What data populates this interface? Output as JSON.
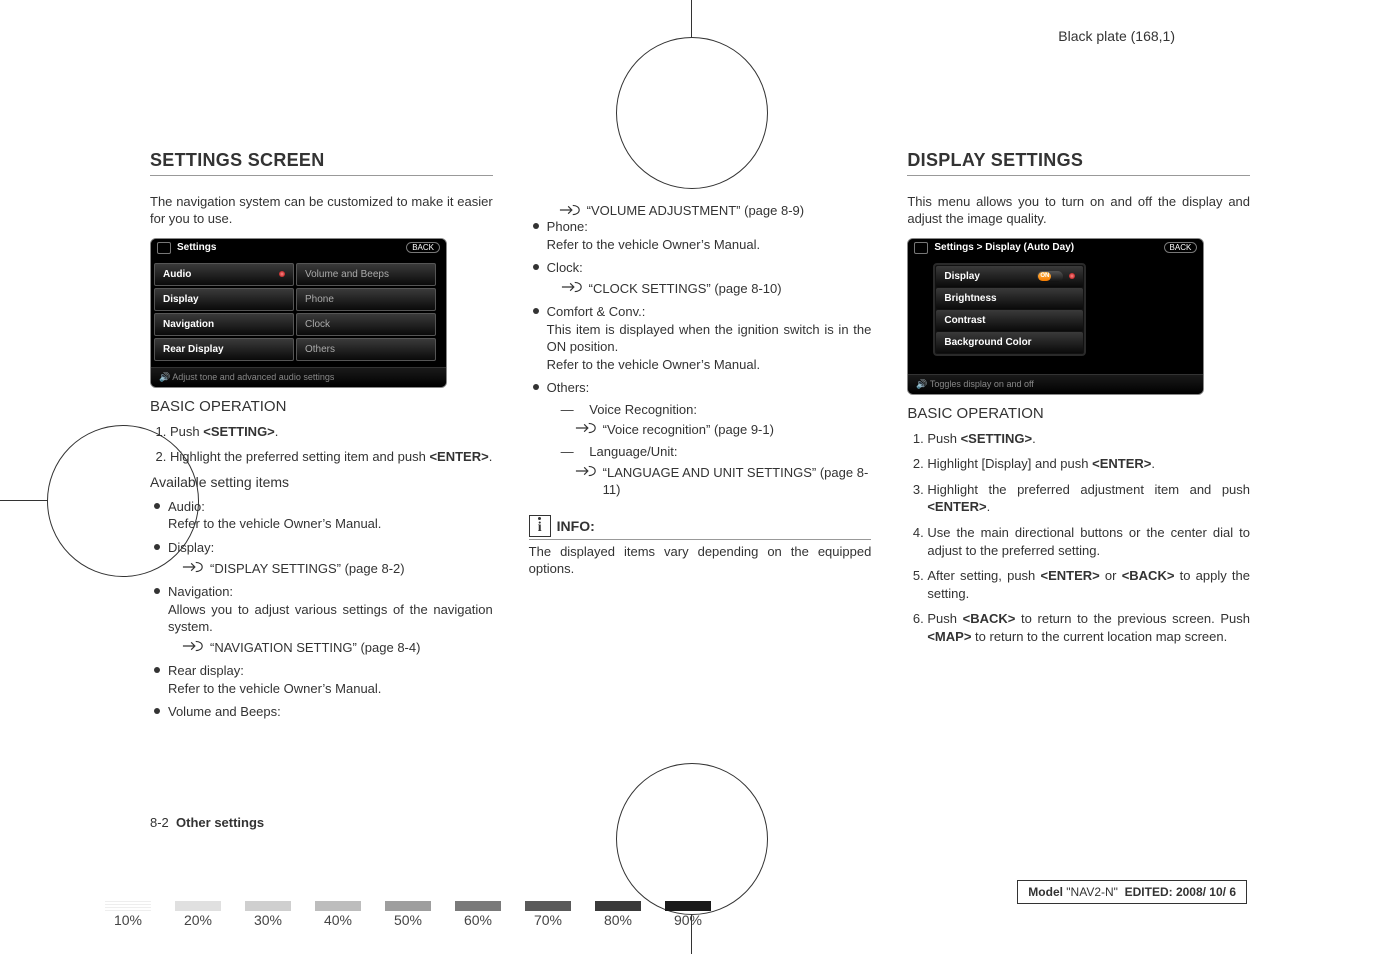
{
  "plate_label": "Black plate (168,1)",
  "col1": {
    "heading": "SETTINGS SCREEN",
    "intro": "The navigation system can be customized to make it easier for you to use.",
    "ss_title": "Settings",
    "ss_back": "BACK",
    "ss_left": [
      "Audio",
      "Display",
      "Navigation",
      "Rear Display"
    ],
    "ss_right": [
      "Volume and Beeps",
      "Phone",
      "Clock",
      "Others"
    ],
    "ss_footer": "Adjust tone and advanced audio settings",
    "sub": "BASIC OPERATION",
    "step1_a": "Push ",
    "step1_b": "<SETTING>",
    "step1_c": ".",
    "step2_a": "Highlight the preferred setting item and push ",
    "step2_b": "<ENTER>",
    "step2_c": ".",
    "avail": "Available setting items",
    "audio_t": "Audio:",
    "audio_d": "Refer to the vehicle Owner’s Manual.",
    "display_t": "Display:",
    "display_x": "“DISPLAY SETTINGS” (page 8-2)",
    "nav_t": "Navigation:",
    "nav_d": "Allows you to adjust various settings of the navigation system.",
    "nav_x": "“NAVIGATION SETTING” (page 8-4)",
    "rear_t": "Rear display:",
    "rear_d": "Refer to the vehicle Owner’s Manual.",
    "vol_t": "Volume and Beeps:"
  },
  "col2": {
    "vol_x": "“VOLUME ADJUSTMENT” (page 8-9)",
    "phone_t": "Phone:",
    "phone_d": "Refer to the vehicle Owner’s Manual.",
    "clock_t": "Clock:",
    "clock_x": "“CLOCK SETTINGS” (page 8-10)",
    "comfort_t": "Comfort & Conv.:",
    "comfort_d1": "This item is displayed when the ignition switch is in the ON position.",
    "comfort_d2": "Refer to the vehicle Owner’s Manual.",
    "others_t": "Others:",
    "vr_t": "Voice Recognition:",
    "vr_x": "“Voice recognition” (page 9-1)",
    "lang_t": "Language/Unit:",
    "lang_x": "“LANGUAGE AND UNIT SETTINGS” (page 8-11)",
    "info_label": "INFO:",
    "info_text": "The displayed items vary depending on the equipped options."
  },
  "col3": {
    "heading": "DISPLAY SETTINGS",
    "intro": "This menu allows you to turn on and off the display and adjust the image quality.",
    "ss_title": "Settings > Display (Auto Day)",
    "ss_back": "BACK",
    "ss_items": [
      "Display",
      "Brightness",
      "Contrast",
      "Background Color"
    ],
    "toggle_on": "ON",
    "ss_footer": "Toggles display on and off",
    "sub": "BASIC OPERATION",
    "s1a": "Push ",
    "s1b": "<SETTING>",
    "s1c": ".",
    "s2a": "Highlight [Display] and push ",
    "s2b": "<ENTER>",
    "s2c": ".",
    "s3a": "Highlight the preferred adjustment item and push ",
    "s3b": "<ENTER>",
    "s3c": ".",
    "s4": "Use the main directional buttons or the center dial to adjust to the preferred setting.",
    "s5a": "After setting, push ",
    "s5b": "<ENTER>",
    "s5c": " or ",
    "s5d": "<BACK>",
    "s5e": " to apply the setting.",
    "s6a": "Push ",
    "s6b": "<BACK>",
    "s6c": " to return to the previous screen. Push ",
    "s6d": "<MAP>",
    "s6e": " to return to the current location map screen."
  },
  "page_foot_num": "8-2",
  "page_foot_title": "Other settings",
  "model_a": "Model ",
  "model_b": "\"NAV2-N\"",
  "model_c": "EDITED: 2008/ 10/ 6",
  "pcts": [
    "10%",
    "20%",
    "30%",
    "40%",
    "50%",
    "60%",
    "70%",
    "80%",
    "90%"
  ]
}
